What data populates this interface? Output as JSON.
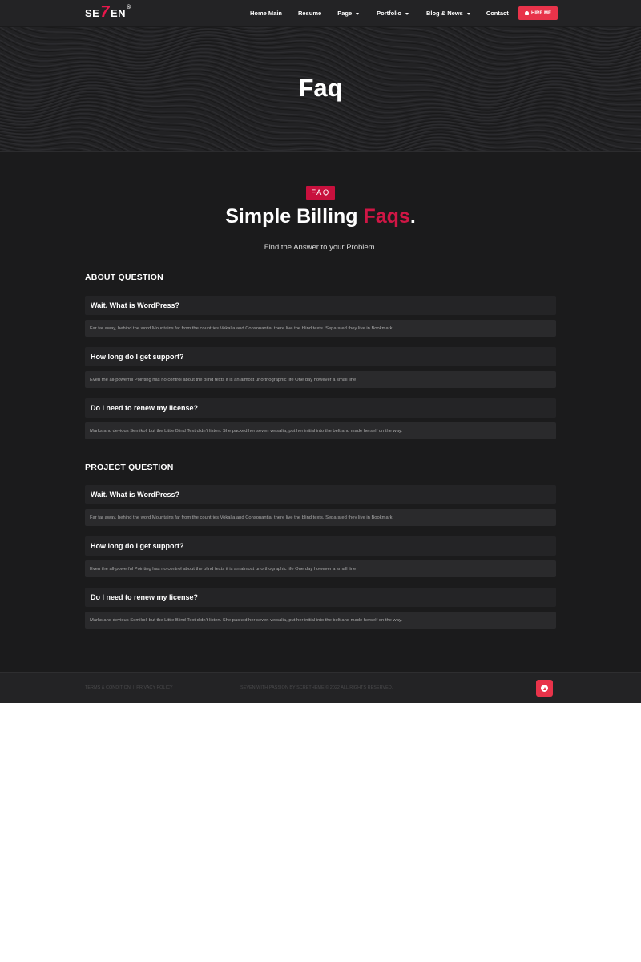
{
  "brand": {
    "logo_left": "SE",
    "logo_seven": "7",
    "logo_right": "EN",
    "logo_reg": "®"
  },
  "nav": {
    "items": [
      {
        "label": "Home Main",
        "dropdown": false
      },
      {
        "label": "Resume",
        "dropdown": false
      },
      {
        "label": "Page",
        "dropdown": true
      },
      {
        "label": "Portfolio",
        "dropdown": true
      },
      {
        "label": "Blog & News",
        "dropdown": true
      },
      {
        "label": "Contact",
        "dropdown": false
      }
    ],
    "hire_label": "HIRE ME"
  },
  "hero": {
    "title": "Faq"
  },
  "faq": {
    "badge": "FAQ",
    "title_main": "Simple Billing",
    "title_accent": "Faqs",
    "title_dot": ".",
    "subtitle": "Find the Answer to your Problem.",
    "groups": [
      {
        "title": "ABOUT QUESTION",
        "items": [
          {
            "q": "Wait. What is WordPress?",
            "a": "Far far away, behind the word Mountains far from the countries Vokalia and Consonantia, there live the blind texts. Separated they live in Bookmark"
          },
          {
            "q": "How long do I get support?",
            "a": "Even the all-powerful Pointing has no control about the blind texts it is an almost unorthographic life One day however a small line"
          },
          {
            "q": "Do I need to renew my license?",
            "a": "Marks and devious Semikoli but the Little Blind Text didn’t listen. She packed her seven versalia, put her initial into the belt and made herself on the way."
          }
        ]
      },
      {
        "title": "PROJECT QUESTION",
        "items": [
          {
            "q": "Wait. What is WordPress?",
            "a": "Far far away, behind the word Mountains far from the countries Vokalia and Consonantia, there live the blind texts. Separated they live in Bookmark"
          },
          {
            "q": "How long do I get support?",
            "a": "Even the all-powerful Pointing has no control about the blind texts it is an almost unorthographic life One day however a small line"
          },
          {
            "q": "Do I need to renew my license?",
            "a": "Marks and devious Semikoli but the Little Blind Text didn’t listen. She packed her seven versalia, put her initial into the belt and made herself on the way."
          }
        ]
      }
    ]
  },
  "footer": {
    "terms": "TERMS & CONDITION",
    "sep": "|",
    "privacy": "PRIVACY POLICY",
    "copyright": "SEVEN WITH PASSION BY SCRETHEME © 2022 ALL RIGHTS RESERVED.",
    "to_top_icon": "arrow-up-circle-icon"
  },
  "colors": {
    "accent": "#e8334a",
    "accent_dark": "#c8103d",
    "background": "#1b1b1c"
  }
}
